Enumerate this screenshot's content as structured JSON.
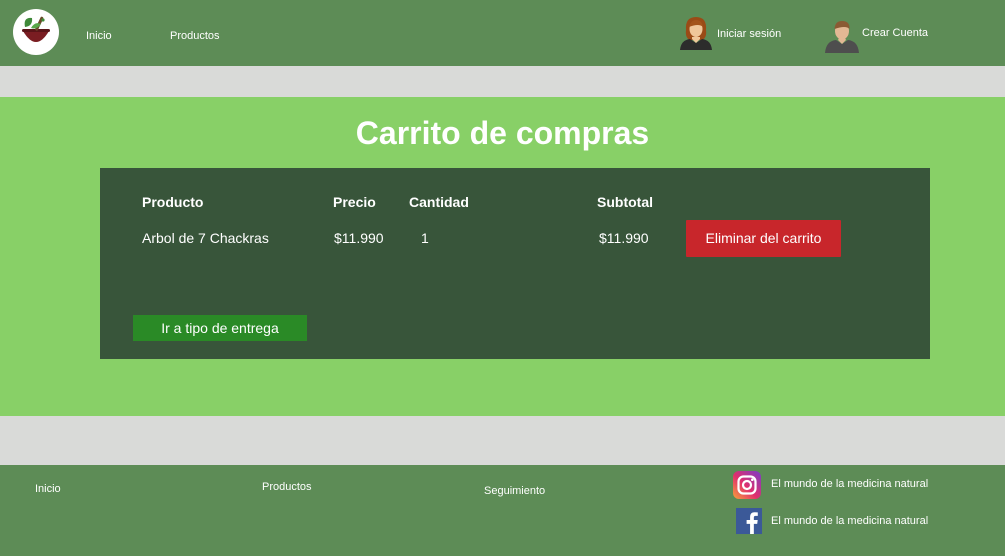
{
  "header": {
    "nav": [
      {
        "label": "Inicio"
      },
      {
        "label": "Productos"
      }
    ],
    "login_label": "Iniciar sesión",
    "register_label": "Crear Cuenta"
  },
  "cart": {
    "title": "Carrito de compras",
    "columns": [
      "Producto",
      "Precio",
      "Cantidad",
      "Subtotal"
    ],
    "items": [
      {
        "product": "Arbol de 7 Chackras",
        "price": "$11.990",
        "quantity": "1",
        "subtotal": "$11.990",
        "remove_label": "Eliminar del carrito"
      }
    ],
    "checkout_label": "Ir a tipo de entrega"
  },
  "footer": {
    "links": [
      {
        "label": "Inicio"
      },
      {
        "label": "Productos"
      },
      {
        "label": "Seguimiento"
      }
    ],
    "social": [
      {
        "icon": "instagram-icon",
        "label": "El mundo de la medicina natural"
      },
      {
        "icon": "facebook-icon",
        "label": "El mundo de la medicina natural"
      }
    ]
  },
  "colors": {
    "header_bg": "#5d8c56",
    "main_bg": "#88d067",
    "panel_bg": "#38553a",
    "remove_button": "#c8262b",
    "checkout_button": "#2a8a26",
    "band_gray": "#d9dad8"
  }
}
